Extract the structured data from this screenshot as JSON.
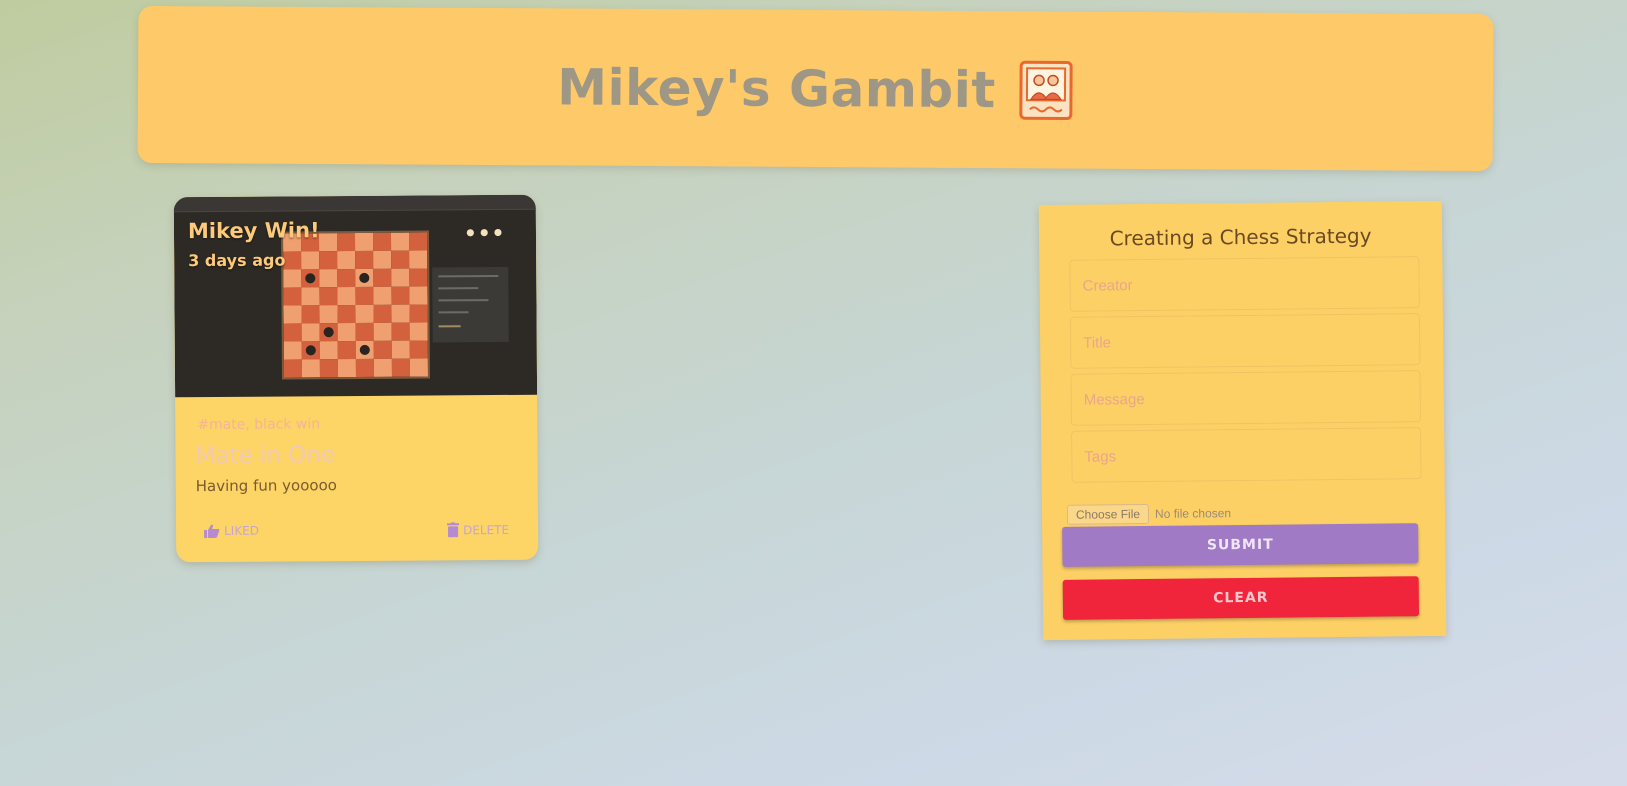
{
  "appbar": {
    "title": "Mikey's Gambit",
    "logo_icon": "photo-frame-icon"
  },
  "post": {
    "creator": "Mikey Win!",
    "time": "3 days ago",
    "more_icon": "more-horizontal-icon",
    "tags": "#mate, black win",
    "title": "Mate in One",
    "message": "Having fun yooooo",
    "like_label": "LIKED",
    "like_icon": "thumb-up-icon",
    "delete_label": "DELETE",
    "delete_icon": "trash-icon"
  },
  "form": {
    "title": "Creating a Chess Strategy",
    "fields": {
      "creator_placeholder": "Creator",
      "title_placeholder": "Title",
      "message_placeholder": "Message",
      "tags_placeholder": "Tags"
    },
    "file_button": "Choose File",
    "file_status": "No file chosen",
    "submit_label": "SUBMIT",
    "clear_label": "CLEAR"
  },
  "colors": {
    "appbar": "#fdc969",
    "card": "#fdd466",
    "submit": "#a07ac4",
    "clear": "#f0243a"
  }
}
